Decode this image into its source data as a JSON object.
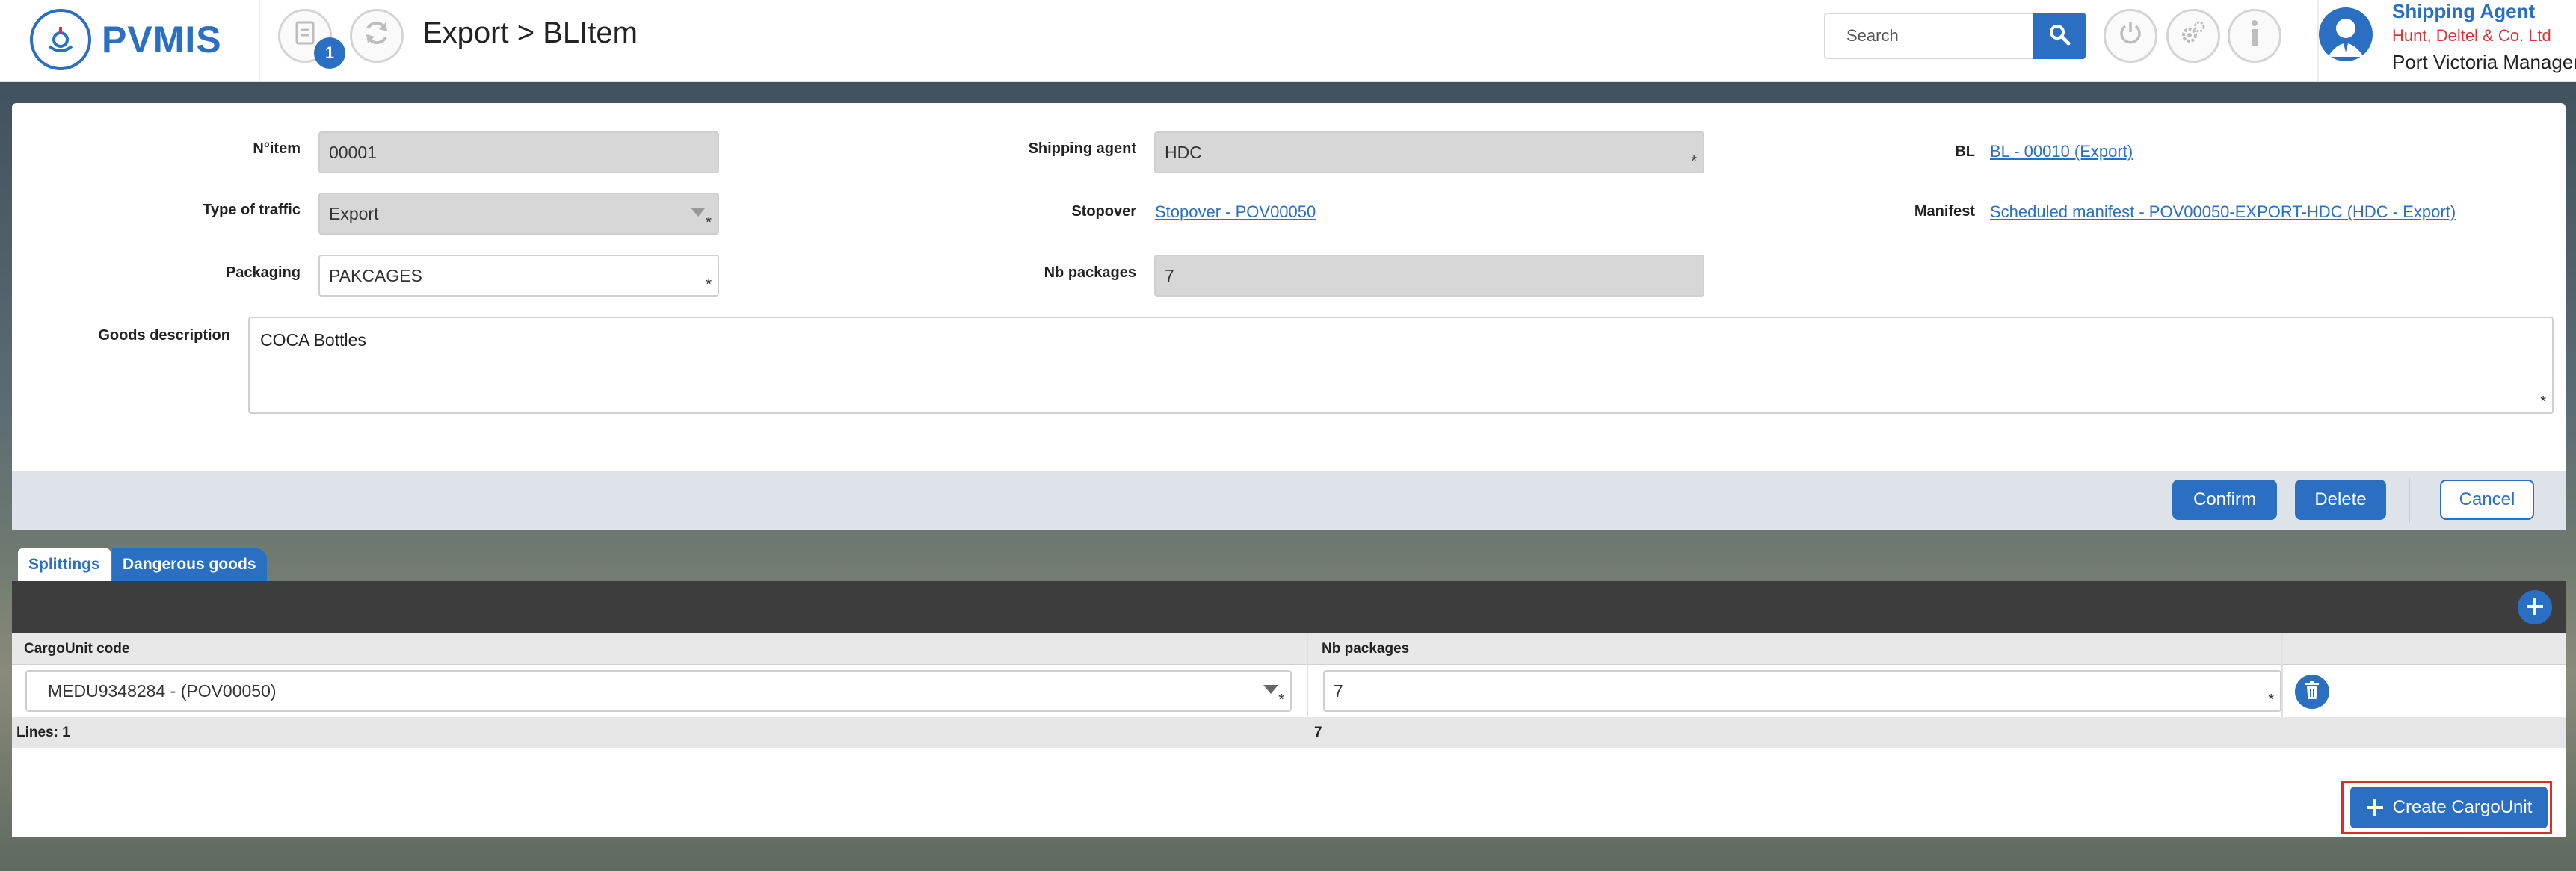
{
  "header": {
    "app_name": "PVMIS",
    "badge_count": "1",
    "title": "Export > BLItem",
    "search_placeholder": "Search",
    "user": {
      "role": "Shipping Agent",
      "company": "Hunt, Deltel & Co. Ltd",
      "port": "Port Victoria Managem"
    }
  },
  "form": {
    "n_item": {
      "label": "N°item",
      "value": "00001"
    },
    "type_of_traffic": {
      "label": "Type of traffic",
      "value": "Export"
    },
    "packaging": {
      "label": "Packaging",
      "value": "PAKCAGES"
    },
    "goods_description": {
      "label": "Goods description",
      "value": "COCA Bottles"
    },
    "shipping_agent": {
      "label": "Shipping agent",
      "value": "HDC"
    },
    "stopover": {
      "label": "Stopover",
      "value": "Stopover - POV00050"
    },
    "nb_packages": {
      "label": "Nb packages",
      "value": "7"
    },
    "bl": {
      "label": "BL",
      "value": "BL - 00010 (Export)"
    },
    "manifest": {
      "label": "Manifest",
      "value": "Scheduled manifest - POV00050-EXPORT-HDC (HDC - Export)"
    },
    "required_mark": "*"
  },
  "actions": {
    "confirm": "Confirm",
    "delete": "Delete",
    "cancel": "Cancel"
  },
  "tabs": [
    {
      "label": "Splittings",
      "active": true
    },
    {
      "label": "Dangerous goods",
      "active": false
    }
  ],
  "grid": {
    "columns": [
      "CargoUnit code",
      "Nb packages"
    ],
    "rows": [
      {
        "cargo_unit": "MEDU9348284 - (POV00050)",
        "nb_packages": "7"
      }
    ],
    "footer": {
      "lines": "Lines: 1",
      "total": "7"
    }
  },
  "create_button": "Create CargoUnit",
  "colors": {
    "primary": "#2b6fc2",
    "toolbar_dark": "#3d3d3d",
    "highlight_red": "#e0292b",
    "company_red": "#dd3333"
  }
}
